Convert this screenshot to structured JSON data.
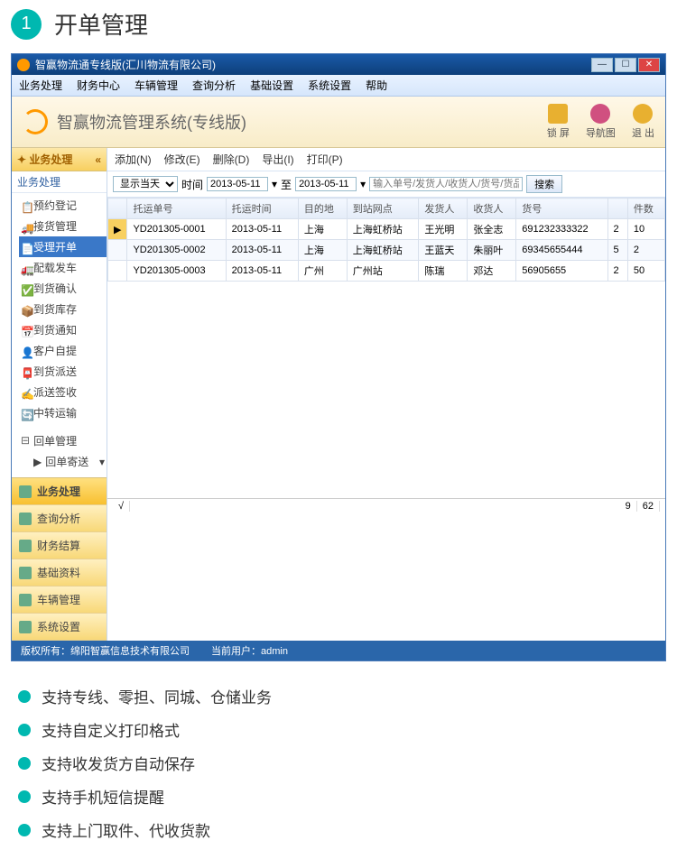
{
  "page_title": "开单管理",
  "page_number": "1",
  "window_title": "智赢物流通专线版(汇川物流有限公司)",
  "menus": [
    "业务处理",
    "财务中心",
    "车辆管理",
    "查询分析",
    "基础设置",
    "系统设置",
    "帮助"
  ],
  "banner_title": "智赢物流管理系统(专线版)",
  "banner_tools": [
    {
      "label": "锁 屏",
      "icon": "lock-icon",
      "color": "#e8b030"
    },
    {
      "label": "导航图",
      "icon": "nav-icon",
      "color": "#d05080"
    },
    {
      "label": "退 出",
      "icon": "exit-icon",
      "color": "#e8b030"
    }
  ],
  "side_header": "业务处理",
  "side_sub": "业务处理",
  "tree": [
    {
      "label": "预约登记",
      "icon": "📋"
    },
    {
      "label": "接货管理",
      "icon": "🚚"
    },
    {
      "label": "受理开单",
      "icon": "📄",
      "active": true
    },
    {
      "label": "配载发车",
      "icon": "🚛"
    },
    {
      "label": "到货确认",
      "icon": "✅"
    },
    {
      "label": "到货库存",
      "icon": "📦"
    },
    {
      "label": "到货通知",
      "icon": "📅"
    },
    {
      "label": "客户自提",
      "icon": "👤"
    },
    {
      "label": "到货派送",
      "icon": "📮"
    },
    {
      "label": "派送签收",
      "icon": "✍"
    },
    {
      "label": "中转运输",
      "icon": "🔄"
    }
  ],
  "tree_group": {
    "label": "回单管理",
    "child": "回单寄送"
  },
  "side_buttons": [
    {
      "label": "业务处理",
      "active": true
    },
    {
      "label": "查询分析"
    },
    {
      "label": "财务结算"
    },
    {
      "label": "基础资料"
    },
    {
      "label": "车辆管理"
    },
    {
      "label": "系统设置"
    }
  ],
  "toolbar": [
    "添加(N)",
    "修改(E)",
    "删除(D)",
    "导出(I)",
    "打印(P)"
  ],
  "filter": {
    "view": "显示当天",
    "time_label": "时间",
    "date1": "2013-05-11",
    "to": "至",
    "date2": "2013-05-11",
    "placeholder": "输入单号/发货人/收货人/货号/货品/备注查询",
    "search": "搜索"
  },
  "columns": [
    "",
    "托运单号",
    "托运时间",
    "目的地",
    "到站网点",
    "发货人",
    "收货人",
    "货号",
    "",
    "件数"
  ],
  "rows": [
    {
      "mark": true,
      "cells": [
        "YD201305-0001",
        "2013-05-11",
        "上海",
        "上海虹桥站",
        "王光明",
        "张全志",
        "691232333322",
        "2",
        "10"
      ]
    },
    {
      "cells": [
        "YD201305-0002",
        "2013-05-11",
        "上海",
        "上海虹桥站",
        "王蓝天",
        "朱丽叶",
        "69345655444",
        "5",
        "2"
      ]
    },
    {
      "cells": [
        "YD201305-0003",
        "2013-05-11",
        "广州",
        "广州站",
        "陈瑞",
        "邓达",
        "56905655",
        "2",
        "50"
      ]
    }
  ],
  "grid_totals": {
    "a": "9",
    "b": "62"
  },
  "status": {
    "copyright": "版权所有：绵阳智赢信息技术有限公司",
    "user_label": "当前用户：",
    "user": "admin"
  },
  "features": [
    "支持专线、零担、同城、仓储业务",
    "支持自定义打印格式",
    "支持收发货方自动保存",
    "支持手机短信提醒",
    "支持上门取件、代收货款"
  ]
}
